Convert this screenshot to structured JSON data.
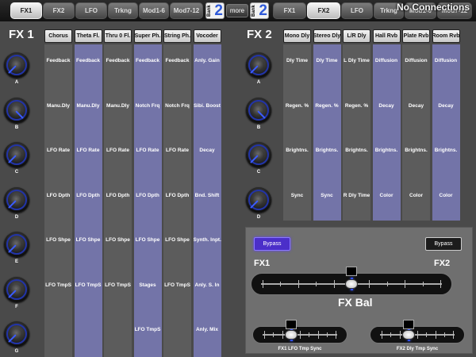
{
  "tabs": [
    {
      "label": "FX1",
      "active": true
    },
    {
      "label": "FX2",
      "active": false
    },
    {
      "label": "LFO",
      "active": false
    },
    {
      "label": "Trkng",
      "active": false
    },
    {
      "label": "Mod1-6",
      "active": false
    },
    {
      "label": "Mod7-12",
      "active": false
    }
  ],
  "tabs_right": [
    {
      "label": "FX1",
      "active": false
    },
    {
      "label": "FX2",
      "active": true
    },
    {
      "label": "LFO",
      "active": false
    },
    {
      "label": "Trkng",
      "active": false
    },
    {
      "label": "Mod1-6",
      "active": false
    },
    {
      "label": "Mod7-12",
      "active": false
    }
  ],
  "bank_left": {
    "word": "Bank",
    "number": "2"
  },
  "bank_right": {
    "word": "Bank",
    "number": "2"
  },
  "more_label": "more",
  "status": "No Connections",
  "fx1": {
    "title": "FX 1",
    "knobs": [
      "A",
      "B",
      "C",
      "D",
      "E",
      "F",
      "G"
    ],
    "columns": [
      {
        "header": "Chorus",
        "shade": "g",
        "params": [
          "Feedback",
          "Manu.Dly",
          "LFO Rate",
          "LFO Dpth",
          "LFO Shpe",
          "LFO TmpS",
          ""
        ]
      },
      {
        "header": "Theta Fl.",
        "shade": "p",
        "params": [
          "Feedback",
          "Manu.Dly",
          "LFO Rate",
          "LFO Dpth",
          "LFO Shpe",
          "LFO TmpS",
          ""
        ]
      },
      {
        "header": "Thru 0 Fl.",
        "shade": "g",
        "params": [
          "Feedback",
          "Manu.Dly",
          "LFO Rate",
          "LFO Dpth",
          "LFO Shpe",
          "LFO TmpS",
          ""
        ]
      },
      {
        "header": "Super Ph.",
        "shade": "p",
        "params": [
          "Feedback",
          "Notch Frq",
          "LFO Rate",
          "LFO Dpth",
          "LFO Shpe",
          "Stages",
          "LFO TmpS"
        ]
      },
      {
        "header": "String Ph.",
        "shade": "g",
        "params": [
          "Feedback",
          "Notch Frq",
          "LFO Rate",
          "LFO Dpth",
          "LFO Shpe",
          "LFO TmpS",
          ""
        ]
      },
      {
        "header": "Vocoder",
        "shade": "p",
        "params": [
          "Anly. Gain",
          "Sibi. Boost",
          "Decay",
          "Bnd. Shift",
          "Synth. Inpt.",
          "Anly. S. In",
          "Anly. Mix"
        ]
      }
    ]
  },
  "fx2": {
    "title": "FX 2",
    "knobs": [
      "A",
      "B",
      "C",
      "D"
    ],
    "columns": [
      {
        "header": "Mono Dly",
        "shade": "g",
        "params": [
          "Dly Time",
          "Regen. %",
          "Brightns.",
          "Sync"
        ]
      },
      {
        "header": "Stereo Dly",
        "shade": "p",
        "params": [
          "Dly Time",
          "Regen. %",
          "Brightns.",
          "Sync"
        ]
      },
      {
        "header": "L/R Dly",
        "shade": "g",
        "params": [
          "L Dly Time",
          "Regen. %",
          "Brightns.",
          "R Dly Time"
        ]
      },
      {
        "header": "Hall Rvb",
        "shade": "p",
        "params": [
          "Diffusion",
          "Decay",
          "Brightns.",
          "Color"
        ]
      },
      {
        "header": "Plate Rvb",
        "shade": "g",
        "params": [
          "Diffusion",
          "Decay",
          "Brightns.",
          "Color"
        ]
      },
      {
        "header": "Room Rvb",
        "shade": "p",
        "params": [
          "Diffusion",
          "Decay",
          "Brightns.",
          "Color"
        ]
      }
    ]
  },
  "balance": {
    "bypass_fx1": "Bypass",
    "bypass_fx2": "Bypass",
    "label_fx1": "FX1",
    "label_fx2": "FX2",
    "title": "FX Bal",
    "value": 0.5,
    "fx1_lfo_sync_label": "FX1 LFO Tmp Sync",
    "fx2_dly_sync_label": "FX2 Dly Tmp Sync",
    "fx1_lfo_sync_value": 0.38,
    "fx2_dly_sync_value": 0.38
  },
  "colors": {
    "accent": "#3b5cff",
    "purple_col": "#7374a8",
    "gray_col": "#5c5c5c",
    "bypass_on": "#4b2fc9"
  }
}
